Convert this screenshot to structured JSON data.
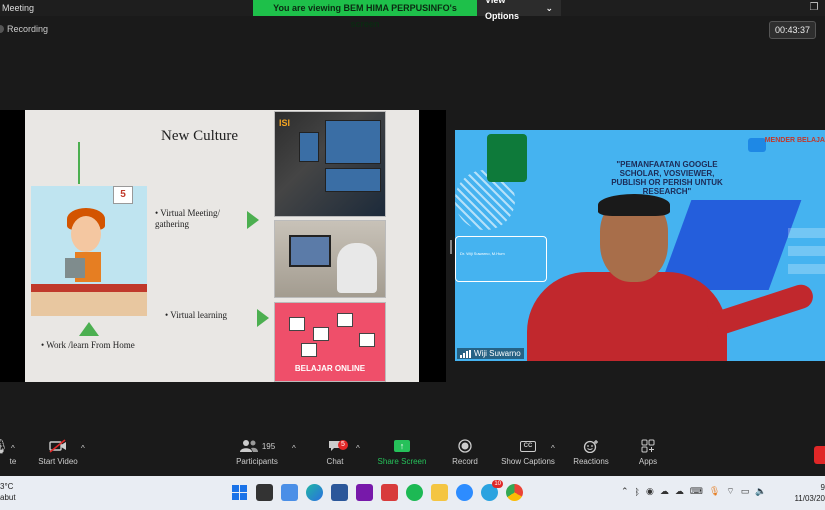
{
  "window": {
    "title": "Meeting",
    "banner_text": "You are viewing BEM HIMA PERPUSINFO's screen",
    "view_options": "View Options"
  },
  "recording": {
    "label": "Recording"
  },
  "timer": "00:43:37",
  "slide": {
    "title": "New Culture",
    "calendar_day": "5",
    "bullet_meeting": "Virtual Meeting/ gathering",
    "bullet_learning": "Virtual learning",
    "bullet_home": "Work /learn From Home",
    "photo1_label": "ISI",
    "photo3_text": "BELAJAR ONLINE"
  },
  "video": {
    "headline": "\"PEMANFAATAN GOOGLE SCHOLAR, VOSVIEWER, PUBLISH OR PERISH UNTUK RESEARCH\"",
    "right_title": "MENDER BELAJA",
    "speaker_box": "Dr. Wiji Suwarno, M.Hum",
    "participant_name": "Wiji Suwarno",
    "accent_red": "#c1282d",
    "bg_blue": "#45b3f0"
  },
  "controls": {
    "mute_label": "te",
    "start_video": "Start Video",
    "participants": "Participants",
    "participants_count": "195",
    "chat": "Chat",
    "chat_badge": "5",
    "share_screen": "Share Screen",
    "record": "Record",
    "show_captions": "Show Captions",
    "captions_icon": "CC",
    "reactions": "Reactions",
    "apps": "Apps",
    "share_color": "#26c15a"
  },
  "taskbar": {
    "weather_temp": "3°C",
    "weather_desc": "abut",
    "telegram_badge": "10",
    "clock_time": "9",
    "clock_date": "11/03/20"
  }
}
